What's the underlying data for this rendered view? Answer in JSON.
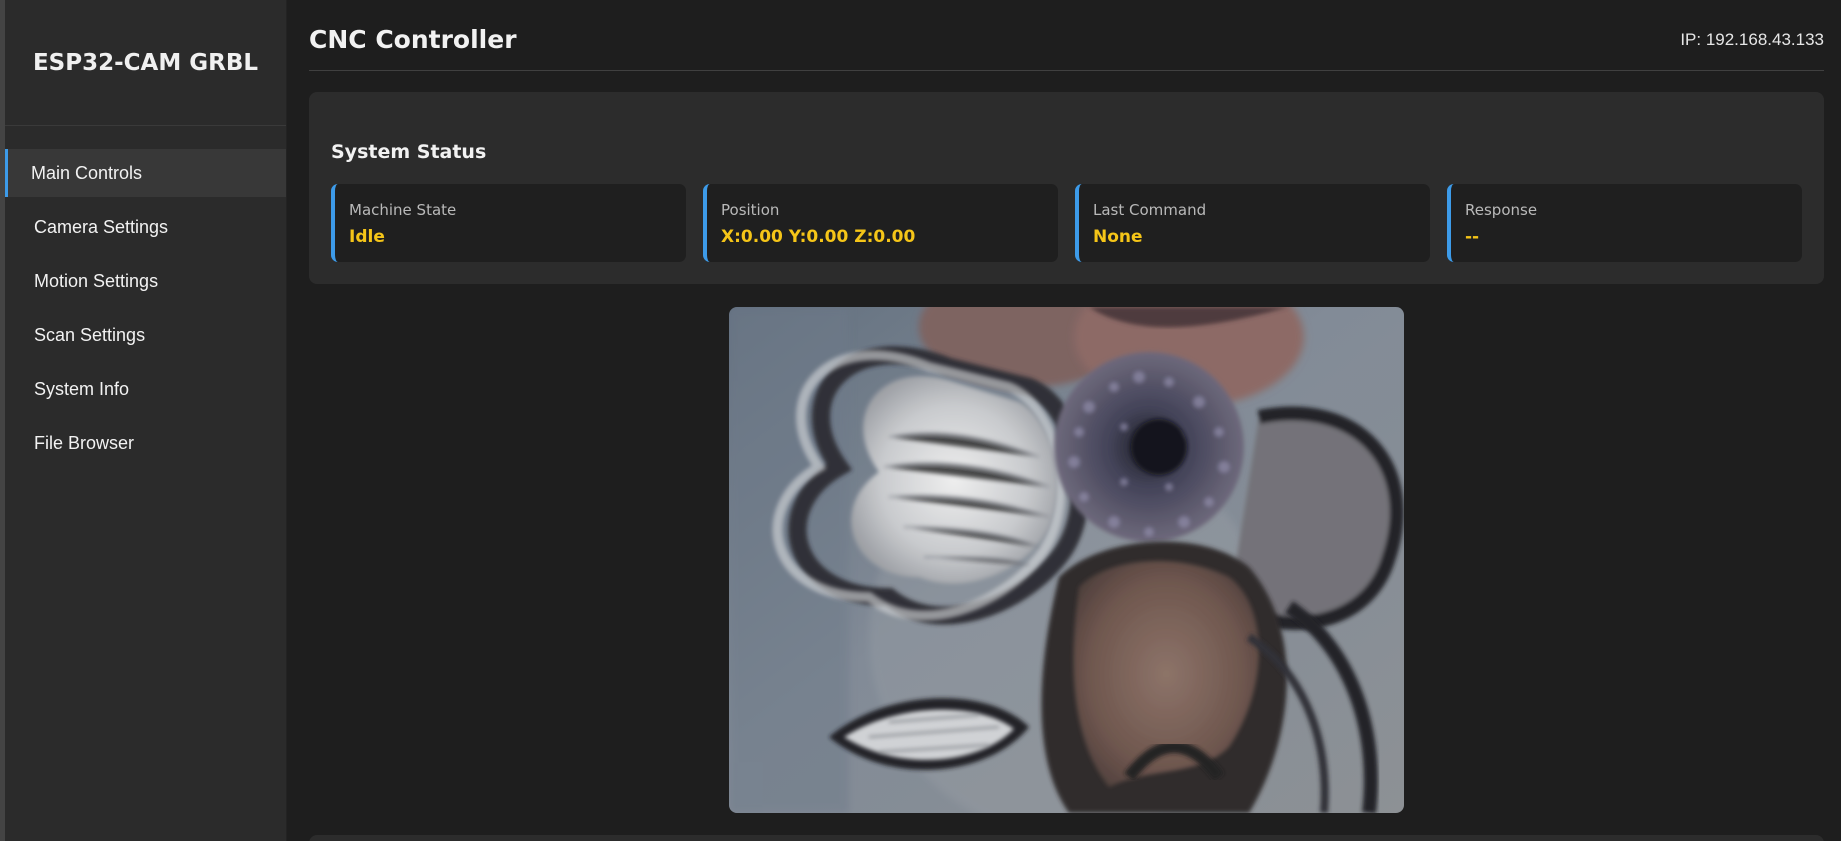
{
  "sidebar": {
    "brand": "ESP32-CAM GRBL",
    "items": [
      {
        "label": "Main Controls",
        "active": true
      },
      {
        "label": "Camera Settings",
        "active": false
      },
      {
        "label": "Motion Settings",
        "active": false
      },
      {
        "label": "Scan Settings",
        "active": false
      },
      {
        "label": "System Info",
        "active": false
      },
      {
        "label": "File Browser",
        "active": false
      }
    ]
  },
  "header": {
    "title": "CNC Controller",
    "ip": "IP: 192.168.43.133"
  },
  "status": {
    "title": "System Status",
    "cards": [
      {
        "label": "Machine State",
        "value": "Idle"
      },
      {
        "label": "Position",
        "value": "X:0.00 Y:0.00 Z:0.00"
      },
      {
        "label": "Last Command",
        "value": "None"
      },
      {
        "label": "Response",
        "value": "--"
      }
    ]
  },
  "camera": {
    "subject": "camera-stream"
  },
  "colors": {
    "accent": "#3d9be9",
    "value": "#f5c518",
    "sidebar_bg": "#2b2b2b",
    "page_bg": "#1e1e1e",
    "panel_bg": "#2c2c2c"
  }
}
